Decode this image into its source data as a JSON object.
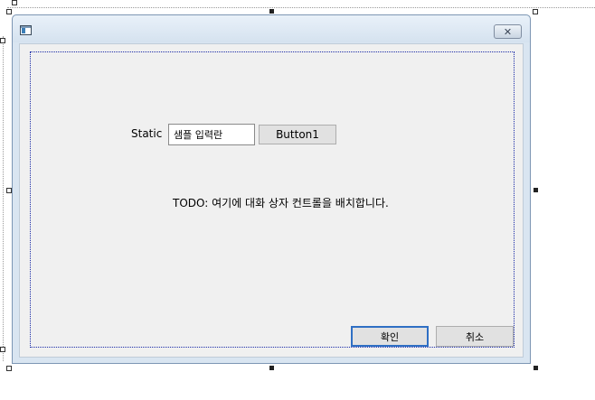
{
  "window": {
    "title": "",
    "close_glyph": "✕"
  },
  "dialog": {
    "static_label": "Static",
    "sample_input_value": "샘플 입력란",
    "button1_label": "Button1",
    "todo_text": "TODO: 여기에 대화 상자 컨트롤을 배치합니다.",
    "ok_label": "확인",
    "cancel_label": "취소"
  },
  "icons": {
    "app": "dialog-app-icon",
    "close": "close-icon"
  },
  "colors": {
    "title_bar": "#d9e5f1",
    "client_bg": "#f0f0f0",
    "margin_guide": "#1b2ca8",
    "default_button_border": "#2f6fc4"
  }
}
